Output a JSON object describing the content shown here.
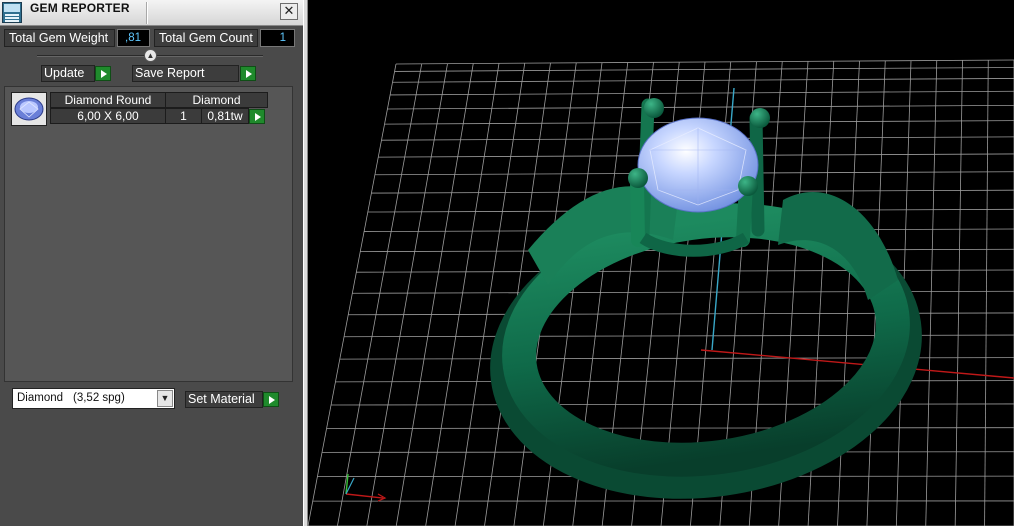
{
  "window": {
    "title": "GEM REPORTER",
    "close_label": "✕"
  },
  "summary": {
    "weight_label": "Total Gem Weight",
    "weight_value": ",81",
    "count_label": "Total Gem Count",
    "count_value": "1"
  },
  "actions": {
    "update_label": "Update",
    "save_report_label": "Save Report"
  },
  "gem_table": {
    "rows": [
      {
        "shape": "Diamond Round",
        "material": "Diamond",
        "size": "6,00 X 6,00",
        "count": "1",
        "weight": "0,81tw"
      }
    ]
  },
  "material_selector": {
    "name": "Diamond",
    "spg": "(3,52 spg)",
    "set_label": "Set Material"
  },
  "viewport": {
    "colors": {
      "background": "#000000",
      "grid": "#bfbfbf",
      "ring": "#0f6a4a",
      "gem": "#a9c4ff",
      "axis_x": "#c01818",
      "axis_y": "#39a8c8"
    },
    "icons": [
      "gem-icon",
      "axis-gizmo-icon"
    ]
  }
}
